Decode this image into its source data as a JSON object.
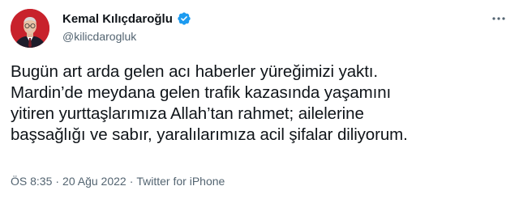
{
  "user": {
    "display_name": "Kemal Kılıçdaroğlu",
    "handle": "@kilicdarogluk",
    "verified": true,
    "verified_color": "#1d9bf0",
    "avatar_icon": "profile-photo"
  },
  "tweet": {
    "text": "Bugün art arda gelen acı haberler yüreğimizi yaktı.\nMardin’de meydana gelen trafik kazasında yaşamını\nyitiren yurttaşlarımıza Allah’tan rahmet; ailelerine\nbaşsağlığı ve sabır, yaralılarımıza acil şifalar diliyorum."
  },
  "meta": {
    "time": "ÖS 8:35",
    "separator1": "·",
    "date": "20 Ağu 2022",
    "separator2": "·",
    "source": "Twitter for iPhone"
  },
  "icons": {
    "more": "more-horizontal-icon"
  }
}
